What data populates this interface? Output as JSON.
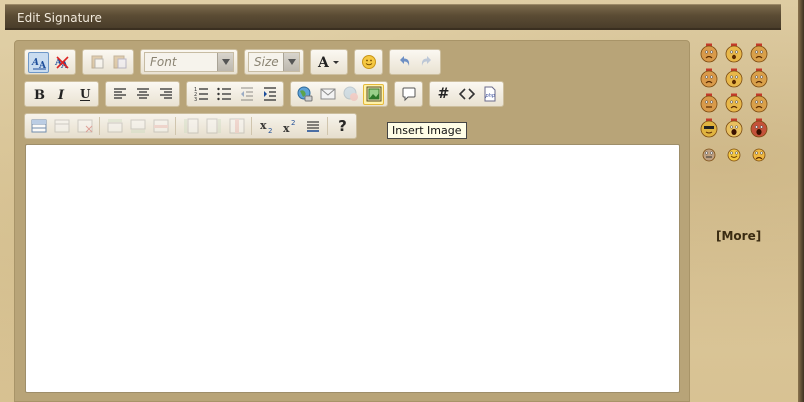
{
  "panel": {
    "title": "Edit Signature"
  },
  "toolbar": {
    "font_label": "Font",
    "size_label": "Size",
    "hash_label": "#",
    "help_label": "?",
    "tooltip": "Insert Image"
  },
  "editor": {
    "content": ""
  },
  "smilies": {
    "items": [
      "frown-face-icon",
      "shocked-face-icon",
      "angry-face-icon",
      "confused-face-icon",
      "surprised-face-icon",
      "mad-face-icon",
      "cool-face-icon",
      "sad-face-icon",
      "worried-face-icon",
      "yellow-shades-face-icon",
      "screaming-face-icon",
      "red-face-icon",
      "rolleyes-face-icon",
      "smile-face-icon",
      "frown-small-face-icon"
    ],
    "more_label": "[More]"
  },
  "colors": {
    "title_bar": "#5b4c34",
    "frame": "#b8a478",
    "tooltip_bg": "#fffde6"
  }
}
